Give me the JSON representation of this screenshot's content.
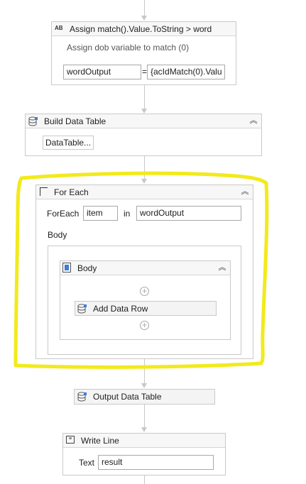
{
  "assign": {
    "title": "Assign match().Value.ToString  > word",
    "annotation": "Assign dob variable to match (0)",
    "to_value": "wordOutput",
    "equals": "=",
    "expression": "{acIdMatch(0).Valu",
    "icon": "AB"
  },
  "build_table": {
    "title": "Build Data Table",
    "button_label": "DataTable..."
  },
  "foreach": {
    "title": "For Each",
    "foreach_label": "ForEach",
    "item_value": "item",
    "in_label": "in",
    "collection_value": "wordOutput",
    "body_label": "Body",
    "inner_body_title": "Body",
    "add_row_label": "Add Data Row"
  },
  "output_table": {
    "title": "Output Data Table"
  },
  "write_line": {
    "title": "Write Line",
    "text_label": "Text",
    "text_value": "result"
  },
  "highlight_color": "#f2ea1c"
}
